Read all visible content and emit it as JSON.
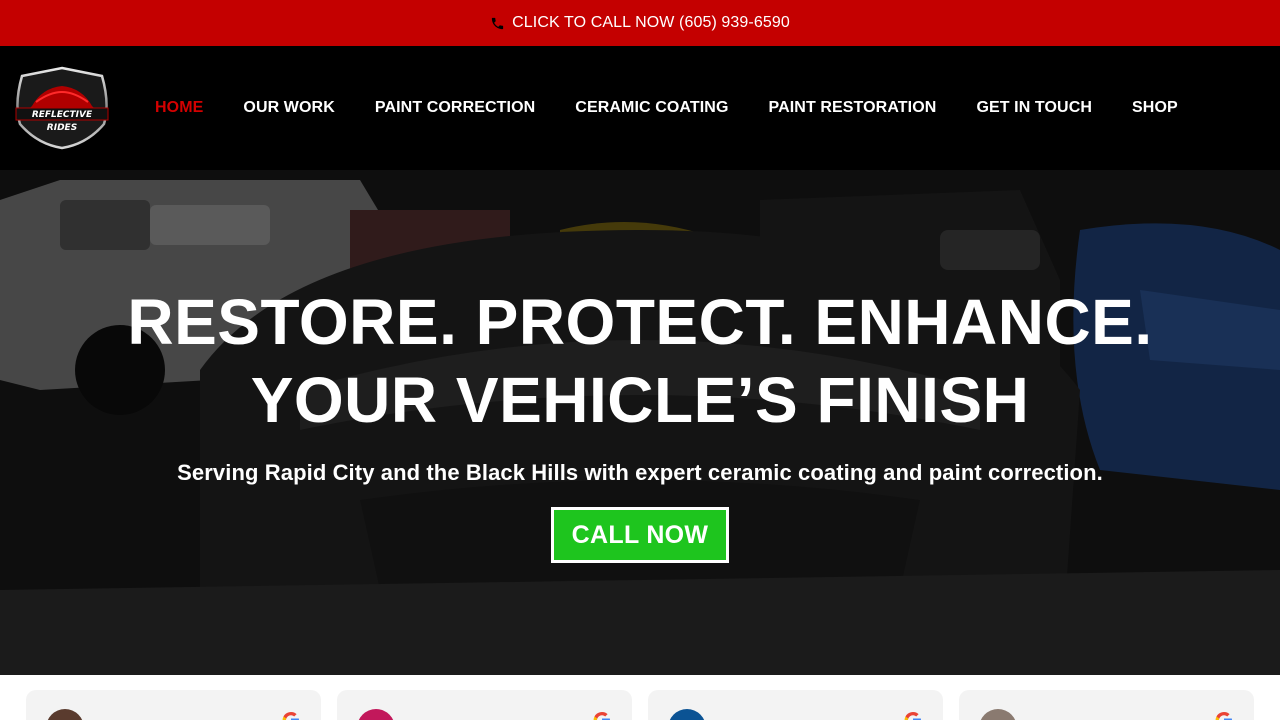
{
  "topbar": {
    "call_text": "CLICK TO CALL NOW (605) 939-6590",
    "icon": "phone-icon"
  },
  "header": {
    "logo_text_line1": "REFLECTIVE",
    "logo_text_line2": "RIDES",
    "nav": [
      {
        "label": "HOME",
        "active": true
      },
      {
        "label": "OUR WORK",
        "active": false
      },
      {
        "label": "PAINT CORRECTION",
        "active": false
      },
      {
        "label": "CERAMIC COATING",
        "active": false
      },
      {
        "label": "PAINT RESTORATION",
        "active": false
      },
      {
        "label": "GET IN TOUCH",
        "active": false
      },
      {
        "label": "SHOP",
        "active": false
      }
    ]
  },
  "hero": {
    "headline_line1": "RESTORE. PROTECT. ENHANCE.",
    "headline_line2": "YOUR VEHICLE’S FINISH",
    "subheadline": "Serving Rapid City and the Black Hills with expert ceramic coating and paint correction.",
    "cta_label": "CALL NOW"
  },
  "reviews": {
    "cards": [
      {
        "avatar_color": "#5a3b2e",
        "icon": "google-icon"
      },
      {
        "avatar_color": "#c2185b",
        "icon": "google-icon"
      },
      {
        "avatar_color": "#0b5394",
        "icon": "google-icon"
      },
      {
        "avatar_color": "#8a7a70",
        "icon": "google-icon"
      }
    ]
  },
  "colors": {
    "topbar_bg": "#c40000",
    "nav_active": "#d40000",
    "cta_bg": "#1ec51e",
    "header_bg": "#000000"
  }
}
